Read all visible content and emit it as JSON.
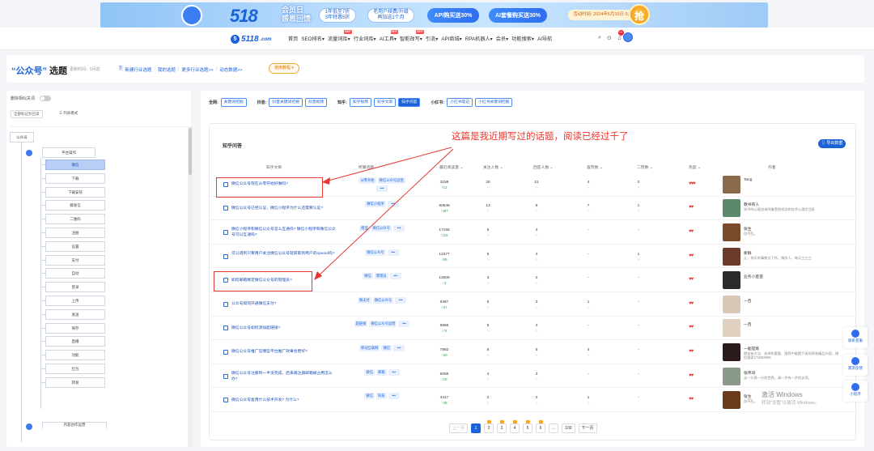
{
  "banner": {
    "logo_text": "518",
    "slogan_line1": "会员日",
    "slogan_line2": "感恩回馈",
    "pill1": "1年低至7折\n3年特惠5折",
    "pill2": "老用户续费/升级\n再加送1个月",
    "pill3": "API购买送30%",
    "pill4": "AI套餐购买送30%",
    "date": "活动时间: 2024年5月16日-5月31日",
    "grab": "抢"
  },
  "nav": {
    "logo": "5118",
    "logo_suffix": ".com",
    "items": [
      {
        "label": "首页",
        "hot": ""
      },
      {
        "label": "SEO排名▾",
        "hot": ""
      },
      {
        "label": "流量词库▾",
        "hot": "HOT"
      },
      {
        "label": "行业词库▾",
        "hot": ""
      },
      {
        "label": "AI工具▾",
        "hot": "HOT"
      },
      {
        "label": "智能改写▾",
        "hot": "HOT"
      },
      {
        "label": "引流▾",
        "hot": ""
      },
      {
        "label": "API商城▾",
        "hot": ""
      },
      {
        "label": "RPA机器人▾",
        "hot": ""
      },
      {
        "label": "会员▾",
        "hot": ""
      },
      {
        "label": "功能搜索▾",
        "hot": ""
      },
      {
        "label": "AI导航",
        "hot": ""
      }
    ],
    "badge": "21"
  },
  "header": {
    "title_prefix": "“公众号”",
    "title_suffix": " 选题",
    "update_time": "更新时间：5月前",
    "links": [
      "新建行业选题",
      "我的选题",
      "更多行业选题>>",
      "动态数据>>"
    ],
    "tutorial": "使用教程 ▾"
  },
  "sidebar": {
    "toggle_label": "删除相似关词",
    "btn_expand": "全部标记为已读",
    "btn_list": "☰ 列表模式",
    "root": "公众号",
    "group": "平台操作",
    "nodes": [
      "微信",
      "下载",
      "下载安装",
      "群发信",
      "二维码",
      "注册",
      "设置",
      "支付",
      "自动",
      "登录",
      "上传",
      "发送",
      "保存",
      "直播",
      "功能",
      "红包",
      "转发"
    ],
    "bottom_group": "内容创作运营"
  },
  "filters": {
    "groups": [
      {
        "label": "全网:",
        "buttons": [
          "关键词挖掘"
        ],
        "on": -1
      },
      {
        "label": "抖音:",
        "buttons": [
          "抖音关键词挖掘",
          "抖音视频"
        ],
        "on": -1
      },
      {
        "label": "知乎:",
        "buttons": [
          "知乎视频",
          "知乎文章",
          "知乎问答"
        ],
        "on": 2
      },
      {
        "label": "小红书:",
        "buttons": [
          "小红书笔记",
          "小红书关键词挖掘"
        ],
        "on": -1
      }
    ]
  },
  "panel": {
    "title": "知乎问答",
    "export": "⇩ 导出数据",
    "annotation": "这篇是我近期写过的话题，阅读已经过千了",
    "columns": [
      "知乎文章",
      "所属话题",
      "最近阅读量 ⌄",
      "关注人数 ⌄",
      "回答人数 ⌄",
      "喜赞数 ⌄",
      "二赞数 ⌄",
      "热度 ⌄",
      "作者"
    ]
  },
  "rows": [
    {
      "title": "微信公众号现在从零开始好做吗?",
      "tags": [
        "从零开始",
        "微信公众号运营"
      ],
      "reads": "3158",
      "reads_d": "↑12",
      "follow": "26",
      "follow_d": "↑-",
      "answers": "21",
      "answers_d": "↑-",
      "likes": "4",
      "likes_d": "↑-",
      "two": "2",
      "two_d": "↑-",
      "heat": "♥♥♥",
      "author": "Tang",
      "desc": "",
      "avatar": "#8a6a4a"
    },
    {
      "title": "微信公众号已经认证，微信小程序为什么还需要认证?",
      "tags": [
        "微信小程序"
      ],
      "reads": "90546",
      "reads_d": "↑467",
      "follow": "13",
      "follow_d": "↑-",
      "answers": "8",
      "answers_d": "↑-",
      "likes": "7",
      "likes_d": "↑-",
      "two": "1",
      "two_d": "↑-",
      "heat": "♥♥",
      "author": "教书育人",
      "desc": "知乎的心理咨询师兼营销科学和技术心理学活跃",
      "avatar": "#5a8a6a"
    },
    {
      "title": "微信小程序和微信公众号怎么互通吗? 微信小程序和微信公众号可以互通吗?",
      "tags": [
        "相当",
        "微信公众号"
      ],
      "reads": "17155",
      "reads_d": "↑115",
      "follow": "5",
      "follow_d": "↑-",
      "answers": "4",
      "answers_d": "↑-",
      "likes": "-",
      "likes_d": "",
      "two": "-",
      "two_d": "",
      "heat": "♥♥",
      "author": "张生",
      "desc": "仅不乱。",
      "avatar": "#7a4a2a"
    },
    {
      "title": "可以调到只要用户关注微信公众号就获取到用户的openid吗?",
      "tags": [
        "微信公众号"
      ],
      "reads": "13377",
      "reads_d": "↑95",
      "follow": "5",
      "follow_d": "↑-",
      "answers": "4",
      "answers_d": "↑-",
      "likes": "-",
      "likes_d": "",
      "two": "1",
      "two_d": "↑-",
      "heat": "♥♥",
      "author": "新鲜",
      "desc": "让，快乐的事物点下所，情仿人，每天三三三",
      "avatar": "#6a3a2a"
    },
    {
      "title": "如何邮箱绑定微信公众号的管理员?",
      "tags": [
        "微信",
        "管理员"
      ],
      "reads": "13006",
      "reads_d": "↑3",
      "follow": "3",
      "follow_d": "↑-",
      "answers": "2",
      "answers_d": "↑-",
      "likes": "-",
      "likes_d": "",
      "two": "-",
      "two_d": "",
      "heat": "♥♥",
      "author": "业务小歪歪",
      "desc": "",
      "avatar": "#2a2a2a"
    },
    {
      "title": "公众号如何开通微信支付?",
      "tags": [
        "微支付",
        "微信公众号"
      ],
      "reads": "9367",
      "reads_d": "↑67",
      "follow": "5",
      "follow_d": "↑-",
      "answers": "3",
      "answers_d": "↑-",
      "likes": "1",
      "likes_d": "↑-",
      "two": "-",
      "two_d": "",
      "heat": "♥♥",
      "author": "一百",
      "desc": "",
      "avatar": "#d9c8b8"
    },
    {
      "title": "微信公众号如何添加超链接?",
      "tags": [
        "超链接",
        "微信公众号运营"
      ],
      "reads": "8966",
      "reads_d": "↑74",
      "follow": "5",
      "follow_d": "↑-",
      "answers": "4",
      "answers_d": "↑-",
      "likes": "-",
      "likes_d": "",
      "two": "-",
      "two_d": "",
      "heat": "♥♥",
      "author": "一百",
      "desc": "",
      "avatar": "#e0d0c0"
    },
    {
      "title": "微信公众号推广在哪些平台推广效果会更好?",
      "tags": [
        "移动互联网",
        "微信"
      ],
      "reads": "7962",
      "reads_d": "↑60",
      "follow": "8",
      "follow_d": "↑-",
      "answers": "5",
      "answers_d": "↑-",
      "likes": "4",
      "likes_d": "↑-",
      "two": "-",
      "two_d": "",
      "heat": "♥♥",
      "author": "一能提炼",
      "desc": "就自有方法、选择和要要、推荐中能提只说现养和精品内容。微信搜索174893988",
      "avatar": "#2a1a1a"
    },
    {
      "title": "微信公众号注册时一半没完成，后来再注册邮箱被占用怎么办?",
      "tags": [
        "微信",
        "邮箱"
      ],
      "reads": "6055",
      "reads_d": "↑19",
      "follow": "4",
      "follow_d": "↑-",
      "answers": "3",
      "answers_d": "↑-",
      "likes": "-",
      "likes_d": "",
      "two": "-",
      "two_d": "",
      "heat": "♥♥",
      "author": "张伟哥",
      "desc": "走一分青一分的世界。请一步有一步的这项。",
      "avatar": "#8a9a8a"
    },
    {
      "title": "微信公众号复用什么技术开发? 为什么?",
      "tags": [
        "微信",
        "科技"
      ],
      "reads": "4417",
      "reads_d": "↑38",
      "follow": "2",
      "follow_d": "↑-",
      "answers": "2",
      "answers_d": "↑-",
      "likes": "1",
      "likes_d": "↑-",
      "two": "-",
      "two_d": "",
      "heat": "♥♥",
      "author": "张生",
      "desc": "仅不乱。",
      "avatar": "#6a3a1a"
    }
  ],
  "pager": {
    "prev": "上一页",
    "pages": [
      "1",
      "2",
      "3",
      "4",
      "5",
      "6",
      "...",
      "100"
    ],
    "next": "下一页"
  },
  "floats": [
    "联系客服",
    "需求反馈",
    "小程序"
  ],
  "windows": {
    "line1": "激活 Windows",
    "line2": "转到“设置”以激活 Windows。"
  }
}
